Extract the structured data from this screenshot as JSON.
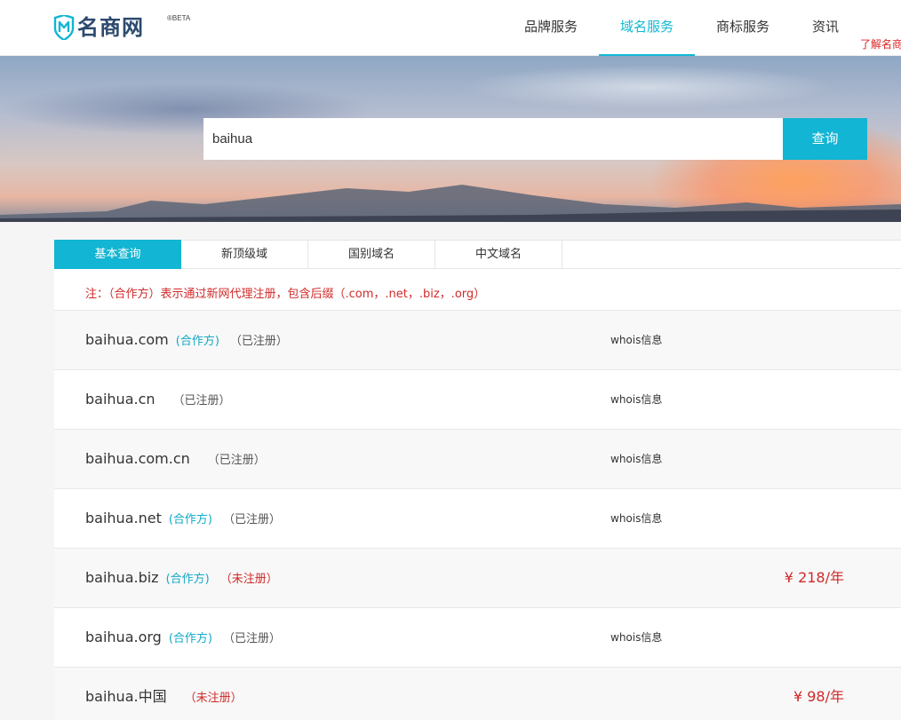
{
  "header": {
    "logo_text": "名商网",
    "logo_badge": "®BETA",
    "nav": [
      {
        "label": "品牌服务",
        "active": false
      },
      {
        "label": "域名服务",
        "active": true
      },
      {
        "label": "商标服务",
        "active": false
      },
      {
        "label": "资讯",
        "active": false
      }
    ],
    "top_link": "了解名商"
  },
  "search": {
    "value": "baihua",
    "button_label": "查询"
  },
  "tabs": [
    {
      "label": "基本查询",
      "active": true
    },
    {
      "label": "新顶级域",
      "active": false
    },
    {
      "label": "国别域名",
      "active": false
    },
    {
      "label": "中文域名",
      "active": false
    }
  ],
  "note": "注：（合作方）表示通过新网代理注册，包含后缀（.com，.net，.biz，.org）",
  "results": [
    {
      "domain": "baihua.com",
      "partner": "(合作方)",
      "status": "（已注册）",
      "registered": true,
      "whois": "whois信息",
      "price": ""
    },
    {
      "domain": "baihua.cn",
      "partner": "",
      "status": "（已注册）",
      "registered": true,
      "whois": "whois信息",
      "price": ""
    },
    {
      "domain": "baihua.com.cn",
      "partner": "",
      "status": "（已注册）",
      "registered": true,
      "whois": "whois信息",
      "price": ""
    },
    {
      "domain": "baihua.net",
      "partner": "(合作方)",
      "status": "（已注册）",
      "registered": true,
      "whois": "whois信息",
      "price": ""
    },
    {
      "domain": "baihua.biz",
      "partner": "(合作方)",
      "status": "（未注册）",
      "registered": false,
      "whois": "",
      "price": "¥ 218/年"
    },
    {
      "domain": "baihua.org",
      "partner": "(合作方)",
      "status": "（已注册）",
      "registered": true,
      "whois": "whois信息",
      "price": ""
    },
    {
      "domain": "baihua.中国",
      "partner": "",
      "status": "（未注册）",
      "registered": false,
      "whois": "",
      "price": "¥ 98/年"
    }
  ],
  "colors": {
    "accent": "#12b5d3",
    "alert": "#d02a2a",
    "logo": "#2c4a6e"
  }
}
